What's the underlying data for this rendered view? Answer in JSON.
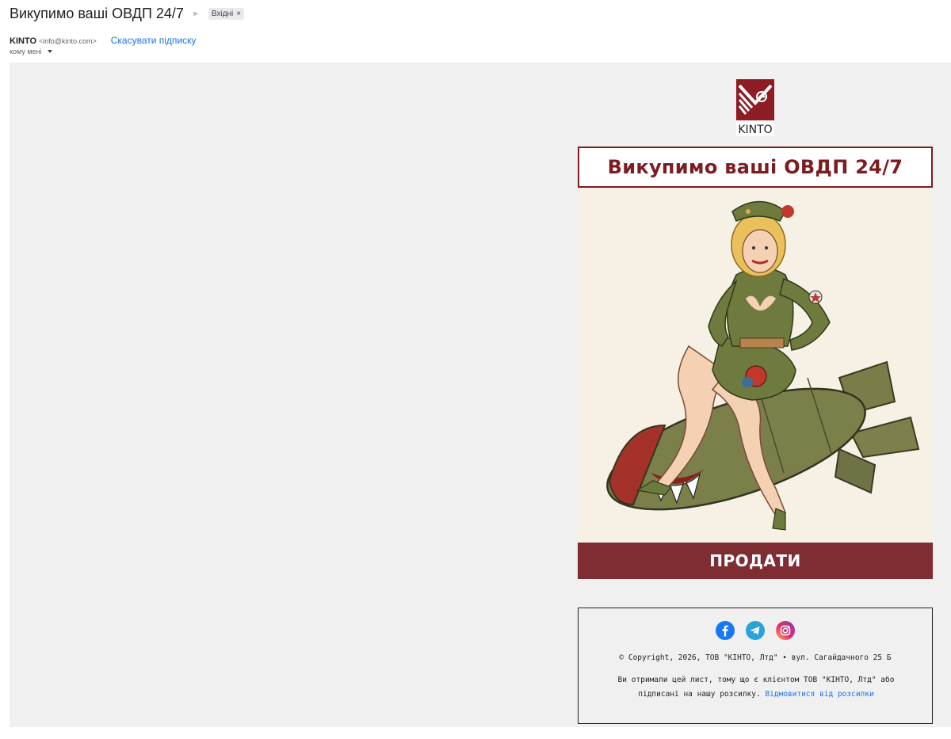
{
  "email": {
    "subject": "Викупимо ваші ОВДП 24/7",
    "label": "Вхідні",
    "label_remove": "×",
    "sender_name": "KINTO",
    "sender_email": "<info@kinto.com>",
    "unsubscribe": "Скасувати підписку",
    "to": "кому мені"
  },
  "newsletter": {
    "logo_text": "KINTO",
    "title": "Викупимо ваші ОВДП 24/7",
    "cta": "ПРОДАТИ",
    "hero_alt": "pin-up girl sitting on a bomb illustration",
    "social": [
      "facebook-icon",
      "telegram-icon",
      "instagram-icon"
    ],
    "copyright": "© Copyright, 2026, ТОВ \"КІНТО, Лтд\" • вул. Сагайдачного 25 Б",
    "notice": "Ви отримали цей лист, тому що є клієнтом ТОВ \"КІНТО, Лтд\" або підписані на нашу розсилку.",
    "opt_out": "Відмовитися від розсилки"
  },
  "colors": {
    "brand": "#7a1e22",
    "cta_bg": "#7f2d33",
    "link": "#1a73e8"
  }
}
